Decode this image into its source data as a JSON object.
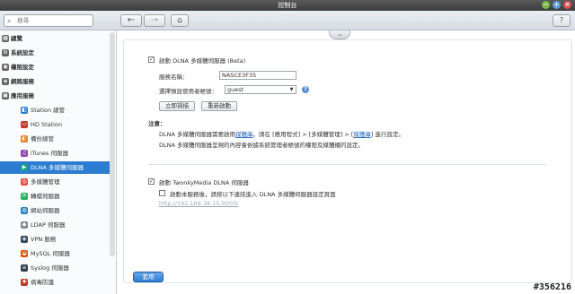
{
  "window": {
    "title": "控制台"
  },
  "toolbar": {
    "search_placeholder": "搜尋",
    "back": "←",
    "forward": "→",
    "home": "⌂",
    "help": "?"
  },
  "sidebar": {
    "items": [
      {
        "label": "總覽",
        "level": "top",
        "icon": "overview-icon",
        "glyph": "▦"
      },
      {
        "label": "系統設定",
        "level": "top",
        "icon": "system-settings-icon",
        "glyph": "⚙"
      },
      {
        "label": "權限設定",
        "level": "top",
        "icon": "privilege-icon",
        "glyph": "◉"
      },
      {
        "label": "網路服務",
        "level": "top",
        "icon": "network-icon",
        "glyph": "◈"
      },
      {
        "label": "應用服務",
        "level": "top",
        "icon": "applications-icon",
        "glyph": "▣"
      },
      {
        "label": "Station 總管",
        "level": "sub",
        "icon": "station-manager-icon",
        "glyph": "◧",
        "color": "#2f7bc8"
      },
      {
        "label": "HD Station",
        "level": "sub",
        "icon": "hd-station-icon",
        "glyph": "▭",
        "color": "#c0392b"
      },
      {
        "label": "備份總管",
        "level": "sub",
        "icon": "backup-icon",
        "glyph": "◐",
        "color": "#e67e22"
      },
      {
        "label": "iTunes 伺服器",
        "level": "sub",
        "icon": "itunes-icon",
        "glyph": "♫",
        "color": "#8e44ad"
      },
      {
        "label": "DLNA 多媒體伺服器",
        "level": "sub",
        "icon": "dlna-icon",
        "glyph": "▶",
        "color": "#16a085",
        "selected": true
      },
      {
        "label": "多媒體管理",
        "level": "sub",
        "icon": "multimedia-icon",
        "glyph": "◎",
        "color": "#e74c3c"
      },
      {
        "label": "轉檔伺服器",
        "level": "sub",
        "icon": "transcode-icon",
        "glyph": "⟳",
        "color": "#27ae60"
      },
      {
        "label": "網站伺服器",
        "level": "sub",
        "icon": "web-server-icon",
        "glyph": "◍",
        "color": "#2980b9"
      },
      {
        "label": "LDAP 伺服器",
        "level": "sub",
        "icon": "ldap-icon",
        "glyph": "◆",
        "color": "#7f8c8d"
      },
      {
        "label": "VPN 服務",
        "level": "sub",
        "icon": "vpn-icon",
        "glyph": "◈",
        "color": "#34495e"
      },
      {
        "label": "MySQL 伺服器",
        "level": "sub",
        "icon": "mysql-icon",
        "glyph": "◒",
        "color": "#d35400"
      },
      {
        "label": "Syslog 伺服器",
        "level": "sub",
        "icon": "syslog-icon",
        "glyph": "≡",
        "color": "#2c3e50"
      },
      {
        "label": "病毒防護",
        "level": "sub",
        "icon": "antivirus-icon",
        "glyph": "✚",
        "color": "#c0392b"
      }
    ]
  },
  "dlna": {
    "enable_label": "啟動 DLNA 多媒體伺服器 (Beta)",
    "enabled": true,
    "service_name_label": "服務名稱：",
    "service_name_value": "NASCE3F35",
    "default_user_label": "選擇預設使用者帳號：",
    "default_user_value": "guest",
    "scan_button": "立即掃描",
    "restart_button": "重新啟動",
    "note_title": "注意：",
    "note_line1_prefix": "DLNA 多媒體伺服器需要啟用",
    "note_line1_link1": "媒體庫",
    "note_line1_mid": "。請在 [應用程式] > [多媒體管理] > [",
    "note_line1_link2": "媒體庫",
    "note_line1_suffix": "] 進行設定。",
    "note_line2": "DLNA 多媒體伺服器呈現的內容會依據系統管理者帳號的權限及媒體櫃的設定。"
  },
  "twonky": {
    "enable_label": "啟動 TwonkyMedia DLNA 伺服器",
    "enabled": true,
    "hint_label": "啟動本服務後，請按以下連結進入 DLNA 多媒體伺服器設定頁面",
    "hint_checked": false,
    "url": "http://192.168.38.15:9000/"
  },
  "footer": {
    "apply_button": "套用"
  },
  "watermark": "#356216",
  "colors": {
    "accent": "#2c7dd1",
    "link": "#2c6fc0"
  }
}
